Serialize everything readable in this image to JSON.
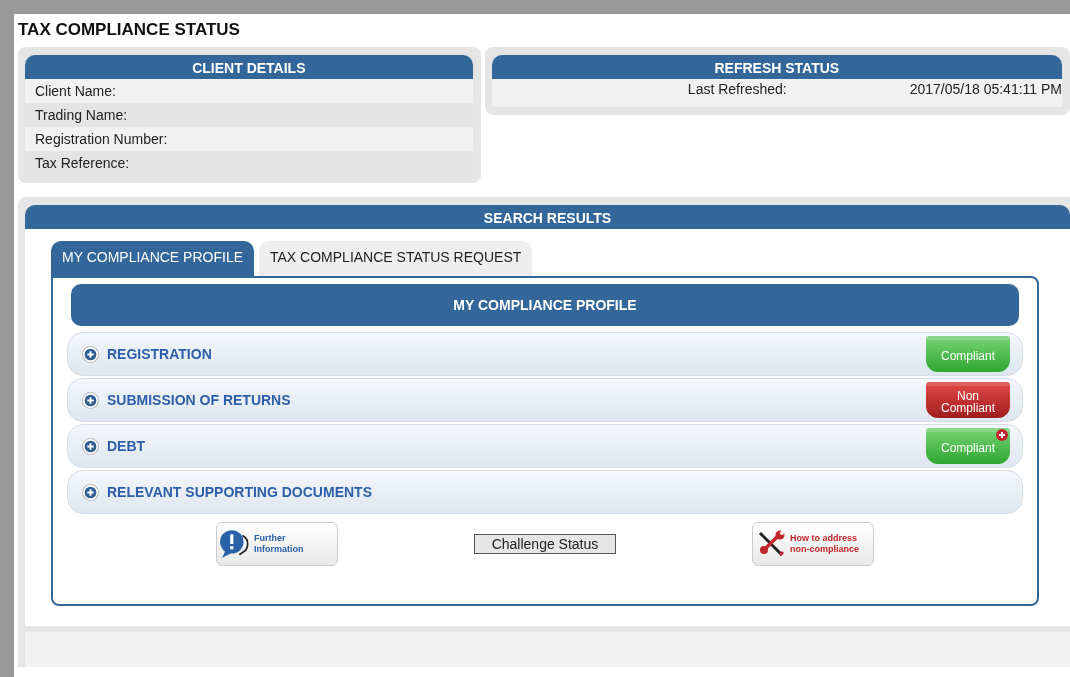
{
  "page_title": "TAX COMPLIANCE STATUS",
  "client_details": {
    "title": "CLIENT DETAILS",
    "fields": [
      {
        "label": "Client Name:"
      },
      {
        "label": "Trading Name:"
      },
      {
        "label": "Registration Number:"
      },
      {
        "label": "Tax Reference:"
      }
    ]
  },
  "refresh_status": {
    "title": "REFRESH STATUS",
    "label": "Last Refreshed:",
    "value": "2017/05/18 05:41:11 PM"
  },
  "search_results": {
    "title": "SEARCH RESULTS",
    "tabs": [
      {
        "label": "MY COMPLIANCE PROFILE",
        "selected": true
      },
      {
        "label": "TAX COMPLIANCE STATUS REQUEST",
        "selected": false
      }
    ],
    "profile_title": "MY COMPLIANCE PROFILE",
    "sections": [
      {
        "label": "REGISTRATION",
        "kind": "compliant",
        "status_lines": [
          "Compliant"
        ],
        "alert": false
      },
      {
        "label": "SUBMISSION OF RETURNS",
        "kind": "noncompliant",
        "status_lines": [
          "Non",
          "Compliant"
        ],
        "alert": false
      },
      {
        "label": "DEBT",
        "kind": "compliant",
        "status_lines": [
          "Compliant"
        ],
        "alert": true
      },
      {
        "label": "RELEVANT SUPPORTING DOCUMENTS",
        "kind": "plain",
        "alert": false
      }
    ],
    "further_info": [
      "Further",
      "Information"
    ],
    "challenge_button": "Challenge Status",
    "noncompliance_help": [
      "How to address",
      "non-compliance"
    ]
  }
}
